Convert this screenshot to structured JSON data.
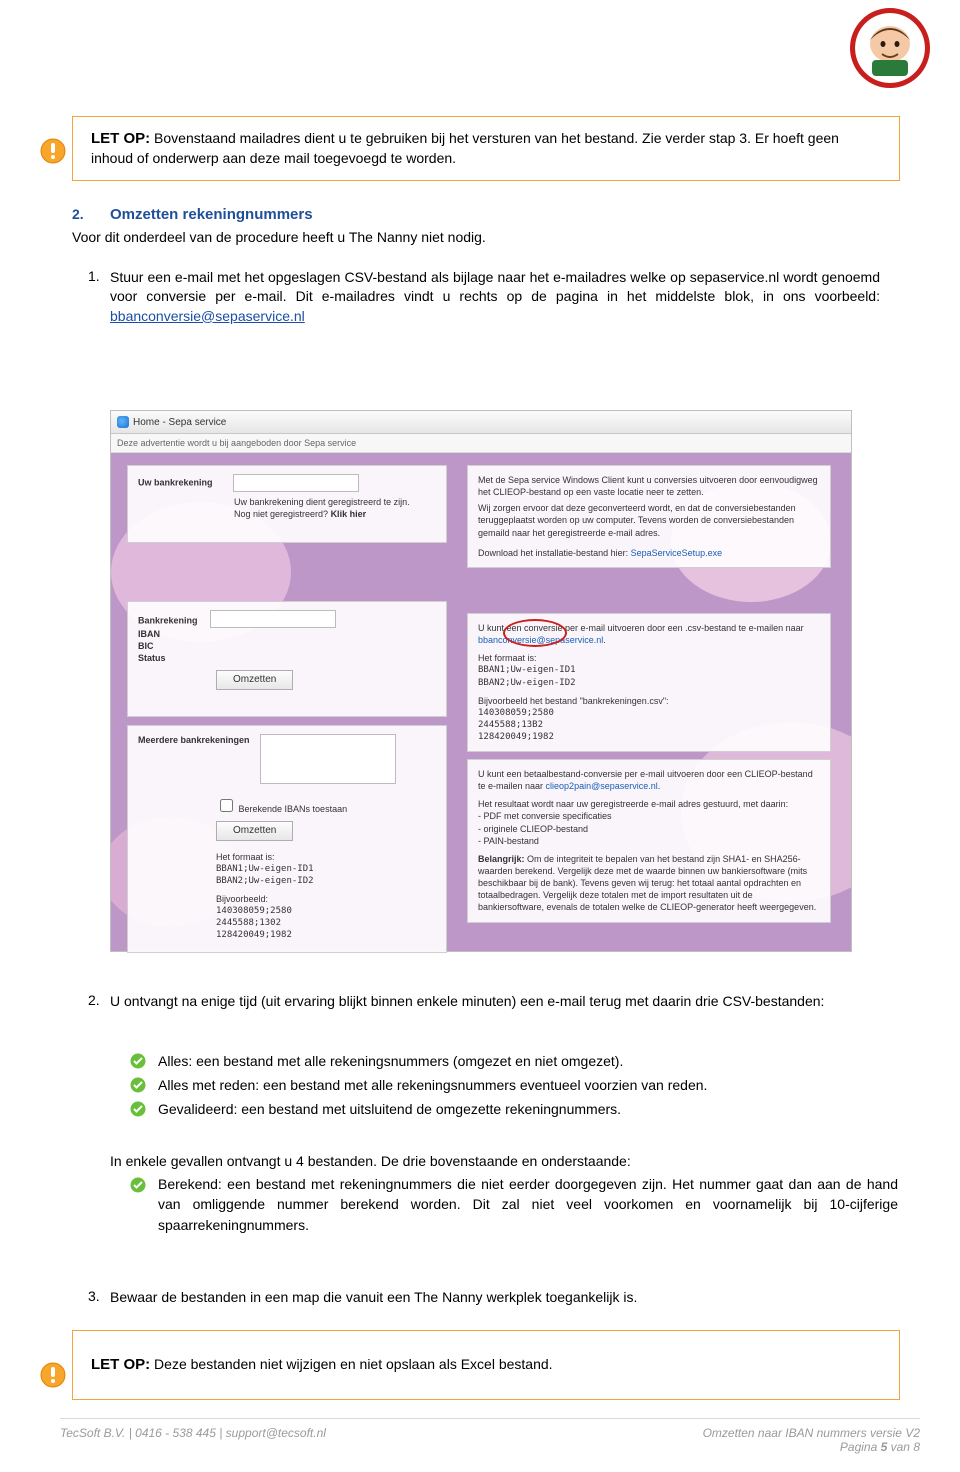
{
  "callout1": {
    "letop": "LET OP:",
    "text": " Bovenstaand mailadres dient u te gebruiken bij het versturen van het bestand. Zie verder stap  3. Er hoeft geen inhoud of onderwerp aan deze mail toegevoegd te worden."
  },
  "section2": {
    "num": "2.",
    "title": "Omzetten rekeningnummers",
    "intro": "Voor dit onderdeel van de procedure heeft u The Nanny niet nodig."
  },
  "step1": {
    "num": "1.",
    "text_a": "Stuur een e-mail met het opgeslagen CSV-bestand als bijlage naar het e-mailadres welke op sepaservice.nl wordt genoemd voor conversie per e-mail. Dit e-mailadres vindt u rechts op de pagina in het middelste blok, in ons voorbeeld: ",
    "link": "bbanconversie@sepaservice.nl"
  },
  "screenshot": {
    "tab": "Home - Sepa service",
    "adbar": "Deze advertentie wordt u bij aangeboden door Sepa service",
    "p_topleft": {
      "label": "Uw bankrekening",
      "line1": "Uw bankrekening dient geregistreerd te zijn.",
      "line2a": "Nog niet geregistreerd? ",
      "line2b": "Klik hier"
    },
    "p_topright": {
      "t1": "Met de Sepa service Windows Client kunt u conversies uitvoeren door eenvoudigweg het CLIEOP-bestand op een vaste locatie neer te zetten.",
      "t2": "Wij zorgen ervoor dat deze geconverteerd wordt, en dat de conversiebestanden teruggeplaatst worden op uw computer. Tevens worden de conversiebestanden gemaild naar het geregistreerde e-mail adres.",
      "t3a": "Download het installatie-bestand hier: ",
      "t3b": "SepaServiceSetup.exe"
    },
    "p_midleft": {
      "l1": "Bankrekening",
      "l2": "IBAN",
      "l3": "BIC",
      "l4": "Status",
      "btn": "Omzetten"
    },
    "p_midright": {
      "t1a": "U kunt een conversie per e-mail uitvoeren door een .csv-bestand te e-mailen naar ",
      "t1b": "bbanconversie@sepaservice.nl",
      "fmt_h": "Het formaat is:",
      "fmt1": "BBAN1;Uw-eigen-ID1",
      "fmt2": "BBAN2;Uw-eigen-ID2",
      "ex_h": "Bijvoorbeeld het bestand \"bankrekeningen.csv\":",
      "ex1": "140308059;2580",
      "ex2": "2445588;13B2",
      "ex3": "128420049;1982"
    },
    "p_botleft": {
      "label": "Meerdere bankrekeningen",
      "chk": "Berekende IBANs toestaan",
      "btn": "Omzetten",
      "fmt_h": "Het formaat is:",
      "fmt1": "BBAN1;Uw-eigen-ID1",
      "fmt2": "BBAN2;Uw-eigen-ID2",
      "ex_h": "Bijvoorbeeld:",
      "ex1": "140308059;2580",
      "ex2": "2445588;1302",
      "ex3": "128420049;1982"
    },
    "p_botright": {
      "t1a": "U kunt een betaalbestand-conversie per e-mail uitvoeren door een CLIEOP-bestand te e-mailen naar ",
      "t1b": "clieop2pain@sepaservice.nl",
      "t2": "Het resultaat wordt naar uw geregistreerde e-mail adres gestuurd, met daarin:",
      "b1": "- PDF met conversie specificaties",
      "b2": "- originele CLIEOP-bestand",
      "b3": "- PAIN-bestand",
      "imp_h": "Belangrijk:",
      "imp": " Om de integriteit te bepalen van het bestand zijn SHA1- en SHA256-waarden berekend. Vergelijk deze met de waarde binnen uw bankiersoftware (mits beschikbaar bij de bank). Tevens geven wij terug: het totaal aantal opdrachten en totaalbedragen. Vergelijk deze totalen met de import resultaten uit de bankiersoftware, evenals de totalen welke de CLIEOP-generator heeft weergegeven."
    }
  },
  "step2": {
    "num": "2.",
    "intro": "U ontvangt na enige tijd (uit ervaring blijkt binnen enkele minuten) een e-mail terug met daarin drie CSV-bestanden:",
    "checks": [
      "Alles: een bestand met alle rekeningsnummers (omgezet en niet omgezet).",
      "Alles met reden: een bestand met alle rekeningsnummers eventueel voorzien van reden.",
      "Gevalideerd: een bestand met uitsluitend de omgezette rekeningnummers."
    ],
    "after": "In enkele gevallen ontvangt u 4 bestanden. De drie bovenstaande en onderstaande:",
    "check4": "Berekend: een bestand met rekeningnummers die niet eerder doorgegeven zijn. Het nummer gaat dan aan de hand van omliggende nummer berekend worden. Dit zal niet veel voorkomen en voornamelijk bij 10-cijferige spaarrekeningnummers."
  },
  "step3": {
    "num": "3.",
    "text": "Bewaar de bestanden in een map die vanuit een The Nanny werkplek toegankelijk is."
  },
  "callout2": {
    "letop": "LET OP:",
    "text": " Deze bestanden niet wijzigen en niet opslaan als Excel bestand."
  },
  "footer": {
    "left": "TecSoft B.V. | 0416 - 538 445 | support@tecsoft.nl",
    "right_a": "Omzetten naar IBAN nummers versie V2",
    "right_b_pre": "Pagina ",
    "right_b_num": "5",
    "right_b_post": " van 8"
  }
}
